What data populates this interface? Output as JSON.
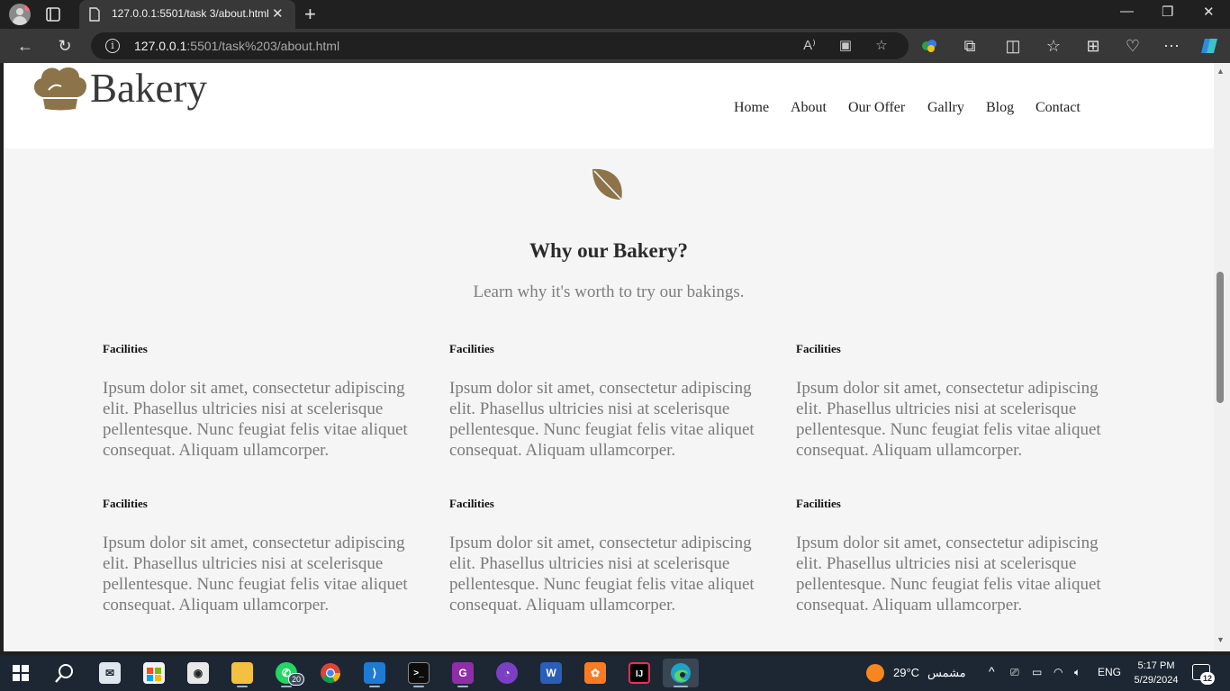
{
  "browser": {
    "tab_title": "127.0.0.1:5501/task 3/about.html",
    "url_host": "127.0.0.1",
    "url_rest": ":5501/task%203/about.html"
  },
  "site": {
    "brand": "Bakery",
    "nav": [
      "Home",
      "About",
      "Our Offer",
      "Gallry",
      "Blog",
      "Contact"
    ],
    "section_title": "Why our Bakery?",
    "section_subtitle": "Learn why it's worth to try our bakings.",
    "features": [
      {
        "title": "Facilities",
        "text": "Ipsum dolor sit amet, consectetur adipiscing elit. Phasellus ultricies nisi at scelerisque pellentesque. Nunc feugiat felis vitae aliquet consequat. Aliquam ullamcorper."
      },
      {
        "title": "Facilities",
        "text": "Ipsum dolor sit amet, consectetur adipiscing elit. Phasellus ultricies nisi at scelerisque pellentesque. Nunc feugiat felis vitae aliquet consequat. Aliquam ullamcorper."
      },
      {
        "title": "Facilities",
        "text": "Ipsum dolor sit amet, consectetur adipiscing elit. Phasellus ultricies nisi at scelerisque pellentesque. Nunc feugiat felis vitae aliquet consequat. Aliquam ullamcorper."
      },
      {
        "title": "Facilities",
        "text": "Ipsum dolor sit amet, consectetur adipiscing elit. Phasellus ultricies nisi at scelerisque pellentesque. Nunc feugiat felis vitae aliquet consequat. Aliquam ullamcorper."
      },
      {
        "title": "Facilities",
        "text": "Ipsum dolor sit amet, consectetur adipiscing elit. Phasellus ultricies nisi at scelerisque pellentesque. Nunc feugiat felis vitae aliquet consequat. Aliquam ullamcorper."
      },
      {
        "title": "Facilities",
        "text": "Ipsum dolor sit amet, consectetur adipiscing elit. Phasellus ultricies nisi at scelerisque pellentesque. Nunc feugiat felis vitae aliquet consequat. Aliquam ullamcorper."
      }
    ],
    "accent_color": "#8c7349"
  },
  "taskbar": {
    "whatsapp_badge": "20",
    "weather_temp": "29°C",
    "weather_text": "مشمس",
    "language": "ENG",
    "time": "5:17 PM",
    "date": "5/29/2024",
    "notifications": "12"
  }
}
